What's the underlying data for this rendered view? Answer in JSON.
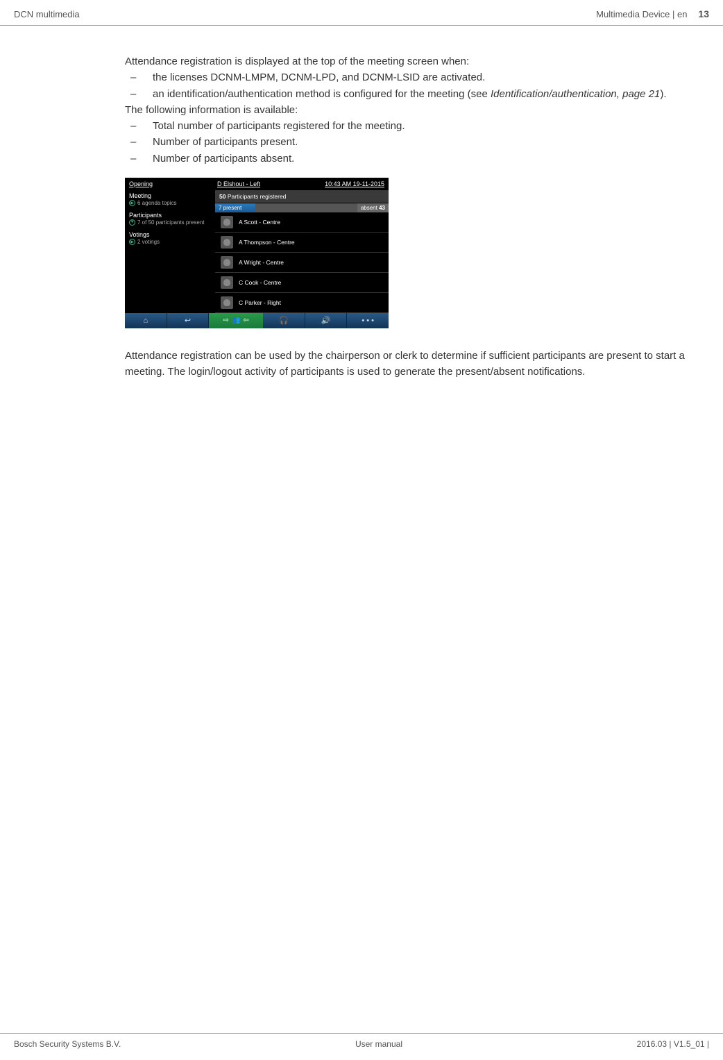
{
  "header": {
    "left": "DCN multimedia",
    "right_label": "Multimedia Device | en",
    "page_number": "13"
  },
  "body": {
    "intro": "Attendance registration is displayed at the top of the meeting screen when:",
    "bullet1": "the licenses DCNM-LMPM, DCNM-LPD, and DCNM-LSID are activated.",
    "bullet2a": "an identification/authentication method is configured for the meeting (see ",
    "bullet2_ref": "Identification/authentication, page 21",
    "bullet2b": ").",
    "intro2": "The following information is available:",
    "info_bullets": [
      "Total number of participants registered for the meeting.",
      "Number of participants present.",
      "Number of participants absent."
    ],
    "para2": "Attendance registration can be used by the chairperson or clerk to determine if sufficient participants are present to start a meeting. The login/logout activity of participants is used to generate the present/absent notifications."
  },
  "device": {
    "topbar": {
      "left": "Opening",
      "center": "D Elshout - Left",
      "right": "10:43 AM 19-11-2015"
    },
    "sidebar": [
      {
        "title": "Meeting",
        "sub": "6 agenda topics",
        "icon": "▶"
      },
      {
        "title": "Participants",
        "sub": "7 of 50 participants present",
        "icon": "▼"
      },
      {
        "title": "Votings",
        "sub": "2 votings",
        "icon": "▶"
      }
    ],
    "registered": {
      "count": "50",
      "label": "Participants registered"
    },
    "present": {
      "count": "7",
      "label": "present"
    },
    "absent": {
      "label": "absent",
      "count": "43"
    },
    "participants": [
      "A Scott - Centre",
      "A Thompson - Centre",
      "A Wright - Centre",
      "C Cook - Centre",
      "C Parker - Right"
    ],
    "bottombar": {
      "home": "⌂",
      "back": "↩",
      "headphones": "🎧",
      "volume": "🔊",
      "more": "• • •"
    }
  },
  "footer": {
    "left": "Bosch Security Systems B.V.",
    "center": "User manual",
    "right": "2016.03 | V1.5_01 |"
  }
}
